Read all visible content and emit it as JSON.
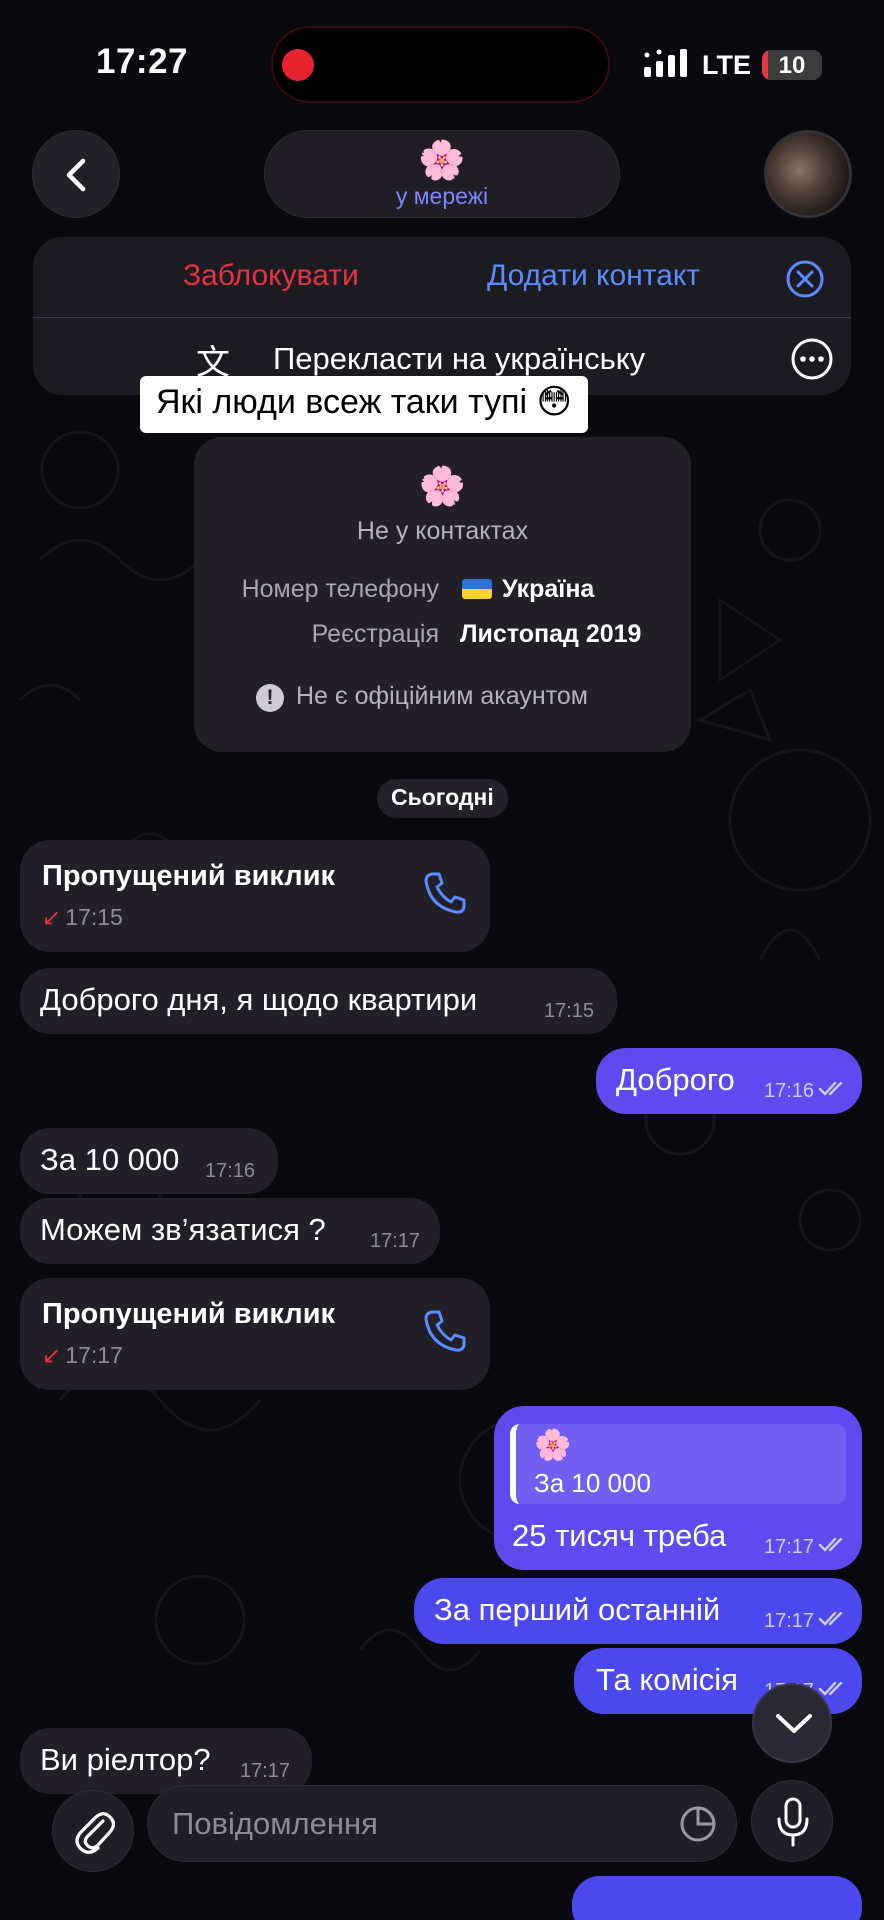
{
  "status_bar": {
    "time": "17:27",
    "network": "LTE",
    "battery": "10",
    "battery_level": 0.1
  },
  "header": {
    "title_emoji": "🌸",
    "status": "у мережі",
    "back_icon": "chevron-left-icon"
  },
  "action_panel": {
    "block": "Заблокувати",
    "add_contact": "Додати контакт",
    "translate_icon": "文",
    "translate": "Перекласти на українську"
  },
  "caption": "Які люди всеж таки тупі 😳",
  "info_card": {
    "emoji": "🌸",
    "not_in_contacts": "Не у контактах",
    "phone_label": "Номер телефону",
    "phone_value": "Україна",
    "reg_label": "Реєстрація",
    "reg_value": "Листопад 2019",
    "warning_mark": "!",
    "warning": "Не є офіційним акаунтом"
  },
  "date_separator": "Сьогодні",
  "messages": [
    {
      "type": "missed_call",
      "title": "Пропущений виклик",
      "arrow": "↙",
      "time": "17:15"
    },
    {
      "dir": "in",
      "text": "Доброго дня, я щодо квартири",
      "time": "17:15"
    },
    {
      "dir": "out",
      "text": "Доброго",
      "time": "17:16"
    },
    {
      "dir": "in",
      "text": "За 10 000",
      "time": "17:16"
    },
    {
      "dir": "in",
      "text": "Можем зв’язатися ?",
      "time": "17:17"
    },
    {
      "type": "missed_call",
      "title": "Пропущений виклик",
      "arrow": "↙",
      "time": "17:17"
    },
    {
      "dir": "out",
      "reply_emoji": "🌸",
      "reply_text": "За 10 000",
      "text": "25 тисяч треба",
      "time": "17:17"
    },
    {
      "dir": "out",
      "text": "За перший останній",
      "time": "17:17"
    },
    {
      "dir": "out",
      "text": "Та комісія",
      "time": "17:17"
    },
    {
      "dir": "in",
      "text": "Ви ріелтор?",
      "time": "17:17"
    }
  ],
  "input": {
    "placeholder": "Повідомлення"
  },
  "colors": {
    "accent": "#5f49ef",
    "danger": "#e3343f",
    "link": "#5a8cff",
    "status": "#7b86ff"
  }
}
